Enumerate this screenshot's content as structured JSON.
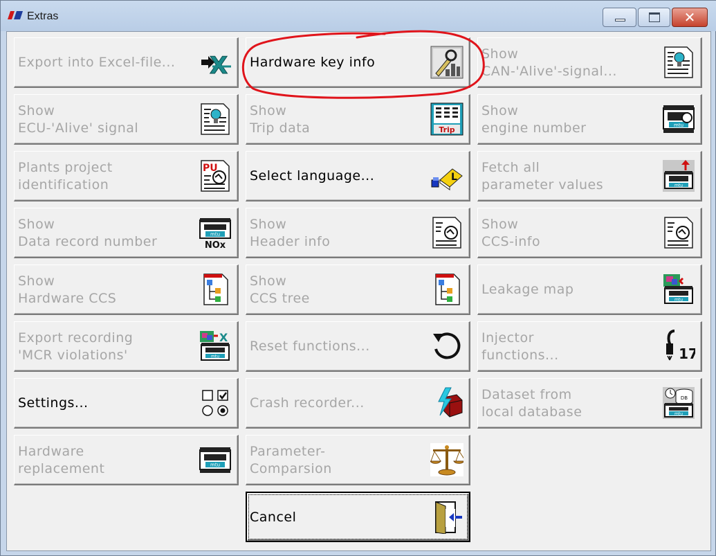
{
  "window": {
    "title": "Extras"
  },
  "buttons": {
    "export_excel": {
      "line1": "Export into Excel-file...",
      "line2": ""
    },
    "hardware_key": {
      "line1": "Hardware key info",
      "line2": ""
    },
    "show_can": {
      "line1": "Show",
      "line2": "CAN-'Alive'-signal..."
    },
    "show_ecu": {
      "line1": "Show",
      "line2": "ECU-'Alive' signal"
    },
    "show_trip": {
      "line1": "Show",
      "line2": "Trip data"
    },
    "show_engine": {
      "line1": "Show",
      "line2": "engine number"
    },
    "plants_project": {
      "line1": "Plants project",
      "line2": "identification"
    },
    "select_language": {
      "line1": "Select language...",
      "line2": ""
    },
    "fetch_params": {
      "line1": "Fetch all",
      "line2": "parameter values"
    },
    "data_record": {
      "line1": "Show",
      "line2": "Data record number"
    },
    "header_info": {
      "line1": "Show",
      "line2": "Header info"
    },
    "ccs_info": {
      "line1": "Show",
      "line2": "CCS-info"
    },
    "hardware_ccs": {
      "line1": "Show",
      "line2": "Hardware CCS"
    },
    "ccs_tree": {
      "line1": "Show",
      "line2": "CCS tree"
    },
    "leakage_map": {
      "line1": "Leakage map",
      "line2": ""
    },
    "export_mcr": {
      "line1": "Export recording",
      "line2": "'MCR violations'"
    },
    "reset_functions": {
      "line1": "Reset functions...",
      "line2": ""
    },
    "injector_functions": {
      "line1": "Injector",
      "line2": "functions..."
    },
    "settings": {
      "line1": "Settings...",
      "line2": ""
    },
    "crash_recorder": {
      "line1": "Crash recorder...",
      "line2": ""
    },
    "dataset_db": {
      "line1": "Dataset from",
      "line2": "local database"
    },
    "hardware_replacement": {
      "line1": "Hardware",
      "line2": "replacement"
    },
    "parameter_comparison": {
      "line1": "Parameter-",
      "line2": "Comparsion"
    },
    "cancel": {
      "line1": "Cancel",
      "line2": ""
    }
  },
  "icon_text": {
    "trip": "Trip",
    "mtu": "mtu",
    "nox": "NOx",
    "pu": "PU",
    "db": "DB",
    "injector_number": "17",
    "language_letter": "L"
  },
  "colors": {
    "disabled_text": "#a6a6a6",
    "enabled_text": "#000000",
    "annotation": "#e0141b",
    "face": "#f0f0f0"
  }
}
